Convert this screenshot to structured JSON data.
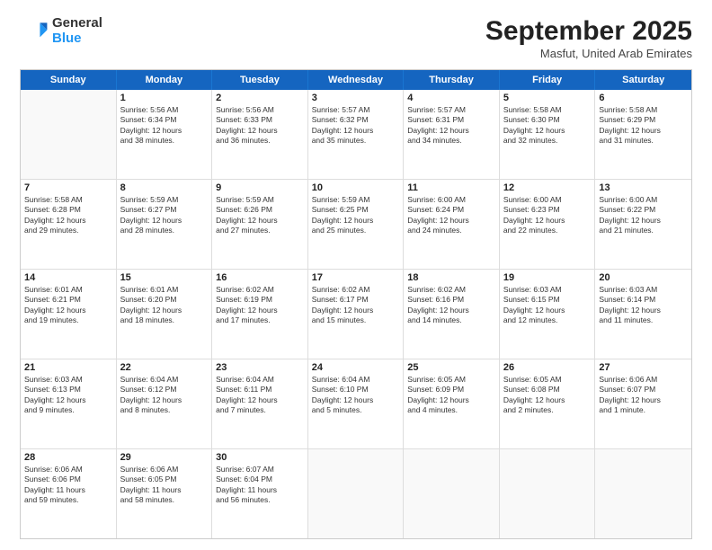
{
  "header": {
    "logo": {
      "general": "General",
      "blue": "Blue"
    },
    "title": "September 2025",
    "subtitle": "Masfut, United Arab Emirates"
  },
  "days_of_week": [
    "Sunday",
    "Monday",
    "Tuesday",
    "Wednesday",
    "Thursday",
    "Friday",
    "Saturday"
  ],
  "rows": [
    [
      {
        "day": "",
        "info": []
      },
      {
        "day": "1",
        "info": [
          "Sunrise: 5:56 AM",
          "Sunset: 6:34 PM",
          "Daylight: 12 hours",
          "and 38 minutes."
        ]
      },
      {
        "day": "2",
        "info": [
          "Sunrise: 5:56 AM",
          "Sunset: 6:33 PM",
          "Daylight: 12 hours",
          "and 36 minutes."
        ]
      },
      {
        "day": "3",
        "info": [
          "Sunrise: 5:57 AM",
          "Sunset: 6:32 PM",
          "Daylight: 12 hours",
          "and 35 minutes."
        ]
      },
      {
        "day": "4",
        "info": [
          "Sunrise: 5:57 AM",
          "Sunset: 6:31 PM",
          "Daylight: 12 hours",
          "and 34 minutes."
        ]
      },
      {
        "day": "5",
        "info": [
          "Sunrise: 5:58 AM",
          "Sunset: 6:30 PM",
          "Daylight: 12 hours",
          "and 32 minutes."
        ]
      },
      {
        "day": "6",
        "info": [
          "Sunrise: 5:58 AM",
          "Sunset: 6:29 PM",
          "Daylight: 12 hours",
          "and 31 minutes."
        ]
      }
    ],
    [
      {
        "day": "7",
        "info": [
          "Sunrise: 5:58 AM",
          "Sunset: 6:28 PM",
          "Daylight: 12 hours",
          "and 29 minutes."
        ]
      },
      {
        "day": "8",
        "info": [
          "Sunrise: 5:59 AM",
          "Sunset: 6:27 PM",
          "Daylight: 12 hours",
          "and 28 minutes."
        ]
      },
      {
        "day": "9",
        "info": [
          "Sunrise: 5:59 AM",
          "Sunset: 6:26 PM",
          "Daylight: 12 hours",
          "and 27 minutes."
        ]
      },
      {
        "day": "10",
        "info": [
          "Sunrise: 5:59 AM",
          "Sunset: 6:25 PM",
          "Daylight: 12 hours",
          "and 25 minutes."
        ]
      },
      {
        "day": "11",
        "info": [
          "Sunrise: 6:00 AM",
          "Sunset: 6:24 PM",
          "Daylight: 12 hours",
          "and 24 minutes."
        ]
      },
      {
        "day": "12",
        "info": [
          "Sunrise: 6:00 AM",
          "Sunset: 6:23 PM",
          "Daylight: 12 hours",
          "and 22 minutes."
        ]
      },
      {
        "day": "13",
        "info": [
          "Sunrise: 6:00 AM",
          "Sunset: 6:22 PM",
          "Daylight: 12 hours",
          "and 21 minutes."
        ]
      }
    ],
    [
      {
        "day": "14",
        "info": [
          "Sunrise: 6:01 AM",
          "Sunset: 6:21 PM",
          "Daylight: 12 hours",
          "and 19 minutes."
        ]
      },
      {
        "day": "15",
        "info": [
          "Sunrise: 6:01 AM",
          "Sunset: 6:20 PM",
          "Daylight: 12 hours",
          "and 18 minutes."
        ]
      },
      {
        "day": "16",
        "info": [
          "Sunrise: 6:02 AM",
          "Sunset: 6:19 PM",
          "Daylight: 12 hours",
          "and 17 minutes."
        ]
      },
      {
        "day": "17",
        "info": [
          "Sunrise: 6:02 AM",
          "Sunset: 6:17 PM",
          "Daylight: 12 hours",
          "and 15 minutes."
        ]
      },
      {
        "day": "18",
        "info": [
          "Sunrise: 6:02 AM",
          "Sunset: 6:16 PM",
          "Daylight: 12 hours",
          "and 14 minutes."
        ]
      },
      {
        "day": "19",
        "info": [
          "Sunrise: 6:03 AM",
          "Sunset: 6:15 PM",
          "Daylight: 12 hours",
          "and 12 minutes."
        ]
      },
      {
        "day": "20",
        "info": [
          "Sunrise: 6:03 AM",
          "Sunset: 6:14 PM",
          "Daylight: 12 hours",
          "and 11 minutes."
        ]
      }
    ],
    [
      {
        "day": "21",
        "info": [
          "Sunrise: 6:03 AM",
          "Sunset: 6:13 PM",
          "Daylight: 12 hours",
          "and 9 minutes."
        ]
      },
      {
        "day": "22",
        "info": [
          "Sunrise: 6:04 AM",
          "Sunset: 6:12 PM",
          "Daylight: 12 hours",
          "and 8 minutes."
        ]
      },
      {
        "day": "23",
        "info": [
          "Sunrise: 6:04 AM",
          "Sunset: 6:11 PM",
          "Daylight: 12 hours",
          "and 7 minutes."
        ]
      },
      {
        "day": "24",
        "info": [
          "Sunrise: 6:04 AM",
          "Sunset: 6:10 PM",
          "Daylight: 12 hours",
          "and 5 minutes."
        ]
      },
      {
        "day": "25",
        "info": [
          "Sunrise: 6:05 AM",
          "Sunset: 6:09 PM",
          "Daylight: 12 hours",
          "and 4 minutes."
        ]
      },
      {
        "day": "26",
        "info": [
          "Sunrise: 6:05 AM",
          "Sunset: 6:08 PM",
          "Daylight: 12 hours",
          "and 2 minutes."
        ]
      },
      {
        "day": "27",
        "info": [
          "Sunrise: 6:06 AM",
          "Sunset: 6:07 PM",
          "Daylight: 12 hours",
          "and 1 minute."
        ]
      }
    ],
    [
      {
        "day": "28",
        "info": [
          "Sunrise: 6:06 AM",
          "Sunset: 6:06 PM",
          "Daylight: 11 hours",
          "and 59 minutes."
        ]
      },
      {
        "day": "29",
        "info": [
          "Sunrise: 6:06 AM",
          "Sunset: 6:05 PM",
          "Daylight: 11 hours",
          "and 58 minutes."
        ]
      },
      {
        "day": "30",
        "info": [
          "Sunrise: 6:07 AM",
          "Sunset: 6:04 PM",
          "Daylight: 11 hours",
          "and 56 minutes."
        ]
      },
      {
        "day": "",
        "info": []
      },
      {
        "day": "",
        "info": []
      },
      {
        "day": "",
        "info": []
      },
      {
        "day": "",
        "info": []
      }
    ]
  ]
}
